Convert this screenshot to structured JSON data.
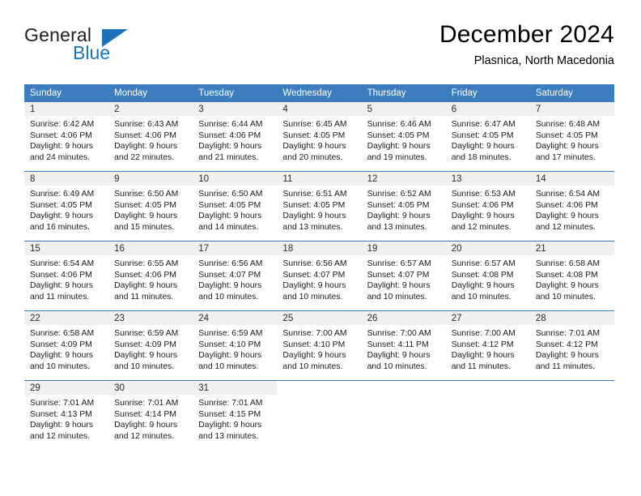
{
  "brand": {
    "name_part1": "General",
    "name_part2": "Blue",
    "accent_color": "#1b72b8"
  },
  "header": {
    "title": "December 2024",
    "subtitle": "Plasnica, North Macedonia"
  },
  "theme": {
    "header_bg": "#3b7dbf",
    "daynum_bg": "#f0f0f0",
    "cell_bg": "#ffffff"
  },
  "weekday_headers": [
    "Sunday",
    "Monday",
    "Tuesday",
    "Wednesday",
    "Thursday",
    "Friday",
    "Saturday"
  ],
  "weeks": [
    [
      {
        "day": "1",
        "sunrise": "Sunrise: 6:42 AM",
        "sunset": "Sunset: 4:06 PM",
        "daylight1": "Daylight: 9 hours",
        "daylight2": "and 24 minutes."
      },
      {
        "day": "2",
        "sunrise": "Sunrise: 6:43 AM",
        "sunset": "Sunset: 4:06 PM",
        "daylight1": "Daylight: 9 hours",
        "daylight2": "and 22 minutes."
      },
      {
        "day": "3",
        "sunrise": "Sunrise: 6:44 AM",
        "sunset": "Sunset: 4:06 PM",
        "daylight1": "Daylight: 9 hours",
        "daylight2": "and 21 minutes."
      },
      {
        "day": "4",
        "sunrise": "Sunrise: 6:45 AM",
        "sunset": "Sunset: 4:05 PM",
        "daylight1": "Daylight: 9 hours",
        "daylight2": "and 20 minutes."
      },
      {
        "day": "5",
        "sunrise": "Sunrise: 6:46 AM",
        "sunset": "Sunset: 4:05 PM",
        "daylight1": "Daylight: 9 hours",
        "daylight2": "and 19 minutes."
      },
      {
        "day": "6",
        "sunrise": "Sunrise: 6:47 AM",
        "sunset": "Sunset: 4:05 PM",
        "daylight1": "Daylight: 9 hours",
        "daylight2": "and 18 minutes."
      },
      {
        "day": "7",
        "sunrise": "Sunrise: 6:48 AM",
        "sunset": "Sunset: 4:05 PM",
        "daylight1": "Daylight: 9 hours",
        "daylight2": "and 17 minutes."
      }
    ],
    [
      {
        "day": "8",
        "sunrise": "Sunrise: 6:49 AM",
        "sunset": "Sunset: 4:05 PM",
        "daylight1": "Daylight: 9 hours",
        "daylight2": "and 16 minutes."
      },
      {
        "day": "9",
        "sunrise": "Sunrise: 6:50 AM",
        "sunset": "Sunset: 4:05 PM",
        "daylight1": "Daylight: 9 hours",
        "daylight2": "and 15 minutes."
      },
      {
        "day": "10",
        "sunrise": "Sunrise: 6:50 AM",
        "sunset": "Sunset: 4:05 PM",
        "daylight1": "Daylight: 9 hours",
        "daylight2": "and 14 minutes."
      },
      {
        "day": "11",
        "sunrise": "Sunrise: 6:51 AM",
        "sunset": "Sunset: 4:05 PM",
        "daylight1": "Daylight: 9 hours",
        "daylight2": "and 13 minutes."
      },
      {
        "day": "12",
        "sunrise": "Sunrise: 6:52 AM",
        "sunset": "Sunset: 4:05 PM",
        "daylight1": "Daylight: 9 hours",
        "daylight2": "and 13 minutes."
      },
      {
        "day": "13",
        "sunrise": "Sunrise: 6:53 AM",
        "sunset": "Sunset: 4:06 PM",
        "daylight1": "Daylight: 9 hours",
        "daylight2": "and 12 minutes."
      },
      {
        "day": "14",
        "sunrise": "Sunrise: 6:54 AM",
        "sunset": "Sunset: 4:06 PM",
        "daylight1": "Daylight: 9 hours",
        "daylight2": "and 12 minutes."
      }
    ],
    [
      {
        "day": "15",
        "sunrise": "Sunrise: 6:54 AM",
        "sunset": "Sunset: 4:06 PM",
        "daylight1": "Daylight: 9 hours",
        "daylight2": "and 11 minutes."
      },
      {
        "day": "16",
        "sunrise": "Sunrise: 6:55 AM",
        "sunset": "Sunset: 4:06 PM",
        "daylight1": "Daylight: 9 hours",
        "daylight2": "and 11 minutes."
      },
      {
        "day": "17",
        "sunrise": "Sunrise: 6:56 AM",
        "sunset": "Sunset: 4:07 PM",
        "daylight1": "Daylight: 9 hours",
        "daylight2": "and 10 minutes."
      },
      {
        "day": "18",
        "sunrise": "Sunrise: 6:56 AM",
        "sunset": "Sunset: 4:07 PM",
        "daylight1": "Daylight: 9 hours",
        "daylight2": "and 10 minutes."
      },
      {
        "day": "19",
        "sunrise": "Sunrise: 6:57 AM",
        "sunset": "Sunset: 4:07 PM",
        "daylight1": "Daylight: 9 hours",
        "daylight2": "and 10 minutes."
      },
      {
        "day": "20",
        "sunrise": "Sunrise: 6:57 AM",
        "sunset": "Sunset: 4:08 PM",
        "daylight1": "Daylight: 9 hours",
        "daylight2": "and 10 minutes."
      },
      {
        "day": "21",
        "sunrise": "Sunrise: 6:58 AM",
        "sunset": "Sunset: 4:08 PM",
        "daylight1": "Daylight: 9 hours",
        "daylight2": "and 10 minutes."
      }
    ],
    [
      {
        "day": "22",
        "sunrise": "Sunrise: 6:58 AM",
        "sunset": "Sunset: 4:09 PM",
        "daylight1": "Daylight: 9 hours",
        "daylight2": "and 10 minutes."
      },
      {
        "day": "23",
        "sunrise": "Sunrise: 6:59 AM",
        "sunset": "Sunset: 4:09 PM",
        "daylight1": "Daylight: 9 hours",
        "daylight2": "and 10 minutes."
      },
      {
        "day": "24",
        "sunrise": "Sunrise: 6:59 AM",
        "sunset": "Sunset: 4:10 PM",
        "daylight1": "Daylight: 9 hours",
        "daylight2": "and 10 minutes."
      },
      {
        "day": "25",
        "sunrise": "Sunrise: 7:00 AM",
        "sunset": "Sunset: 4:10 PM",
        "daylight1": "Daylight: 9 hours",
        "daylight2": "and 10 minutes."
      },
      {
        "day": "26",
        "sunrise": "Sunrise: 7:00 AM",
        "sunset": "Sunset: 4:11 PM",
        "daylight1": "Daylight: 9 hours",
        "daylight2": "and 10 minutes."
      },
      {
        "day": "27",
        "sunrise": "Sunrise: 7:00 AM",
        "sunset": "Sunset: 4:12 PM",
        "daylight1": "Daylight: 9 hours",
        "daylight2": "and 11 minutes."
      },
      {
        "day": "28",
        "sunrise": "Sunrise: 7:01 AM",
        "sunset": "Sunset: 4:12 PM",
        "daylight1": "Daylight: 9 hours",
        "daylight2": "and 11 minutes."
      }
    ],
    [
      {
        "day": "29",
        "sunrise": "Sunrise: 7:01 AM",
        "sunset": "Sunset: 4:13 PM",
        "daylight1": "Daylight: 9 hours",
        "daylight2": "and 12 minutes."
      },
      {
        "day": "30",
        "sunrise": "Sunrise: 7:01 AM",
        "sunset": "Sunset: 4:14 PM",
        "daylight1": "Daylight: 9 hours",
        "daylight2": "and 12 minutes."
      },
      {
        "day": "31",
        "sunrise": "Sunrise: 7:01 AM",
        "sunset": "Sunset: 4:15 PM",
        "daylight1": "Daylight: 9 hours",
        "daylight2": "and 13 minutes."
      },
      {
        "day": "",
        "sunrise": "",
        "sunset": "",
        "daylight1": "",
        "daylight2": ""
      },
      {
        "day": "",
        "sunrise": "",
        "sunset": "",
        "daylight1": "",
        "daylight2": ""
      },
      {
        "day": "",
        "sunrise": "",
        "sunset": "",
        "daylight1": "",
        "daylight2": ""
      },
      {
        "day": "",
        "sunrise": "",
        "sunset": "",
        "daylight1": "",
        "daylight2": ""
      }
    ]
  ]
}
